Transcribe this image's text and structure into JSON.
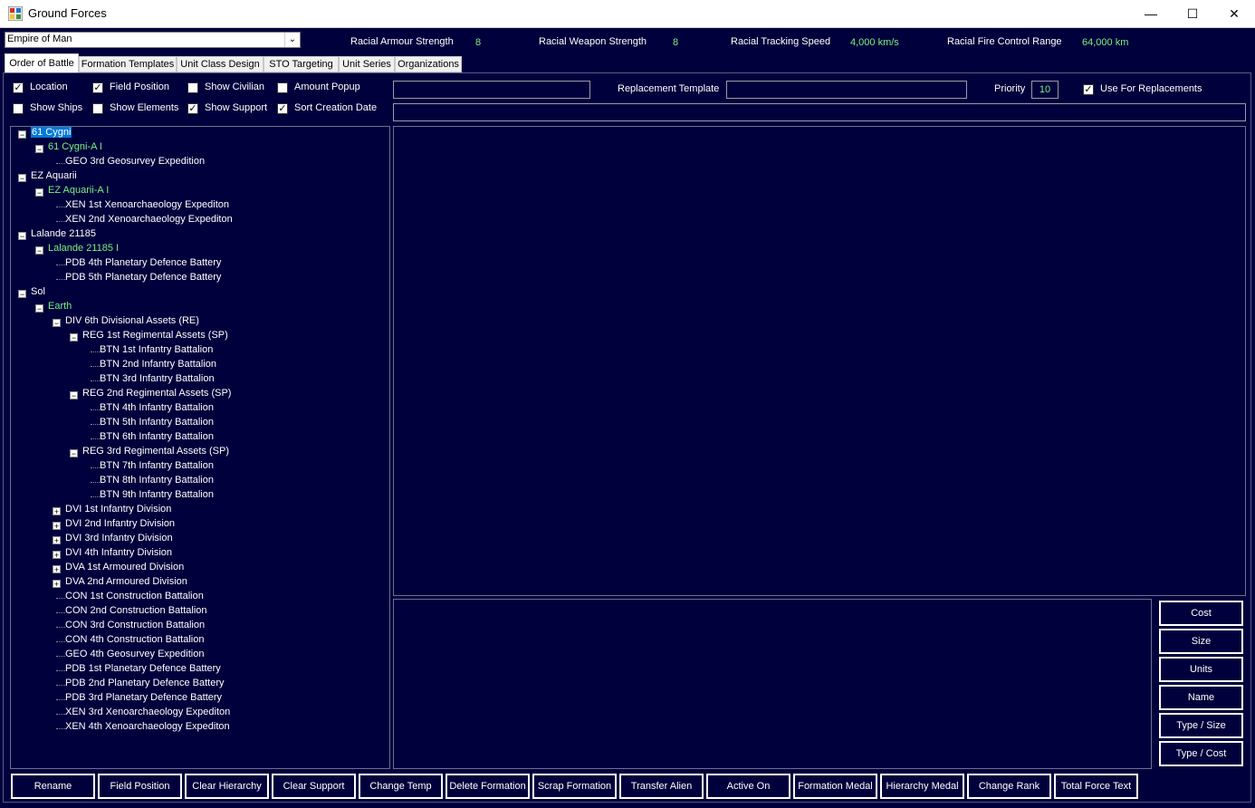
{
  "window": {
    "title": "Ground Forces",
    "minimize": "—",
    "maximize": "☐",
    "close": "✕"
  },
  "race_select": {
    "value": "Empire of Man"
  },
  "stats": [
    {
      "label": "Racial Armour Strength",
      "value": "8"
    },
    {
      "label": "Racial Weapon Strength",
      "value": "8"
    },
    {
      "label": "Racial Tracking Speed",
      "value": "4,000 km/s"
    },
    {
      "label": "Racial Fire Control Range",
      "value": "64,000 km"
    }
  ],
  "tabs": [
    "Order of Battle",
    "Formation Templates",
    "Unit Class Design",
    "STO Targeting",
    "Unit Series",
    "Organizations"
  ],
  "checkboxes": [
    {
      "label": "Location",
      "checked": true
    },
    {
      "label": "Field Position",
      "checked": true
    },
    {
      "label": "Show Civilian",
      "checked": false
    },
    {
      "label": "Amount Popup",
      "checked": false
    },
    {
      "label": "Show Ships",
      "checked": false
    },
    {
      "label": "Show Elements",
      "checked": false
    },
    {
      "label": "Show Support",
      "checked": true
    },
    {
      "label": "Sort Creation Date",
      "checked": true
    }
  ],
  "replacement": {
    "label": "Replacement Template",
    "priority_label": "Priority",
    "priority_value": "10",
    "use_label": "Use For Replacements",
    "use_checked": true
  },
  "tree": [
    {
      "text": "61 Cygni",
      "level": 0,
      "exp": "minus",
      "selected": true
    },
    {
      "text": "61 Cygni-A I",
      "level": 1,
      "exp": "minus",
      "green": true
    },
    {
      "text": "GEO 3rd Geosurvey Expedition",
      "level": 2
    },
    {
      "text": "EZ Aquarii",
      "level": 0,
      "exp": "minus"
    },
    {
      "text": "EZ Aquarii-A I",
      "level": 1,
      "exp": "minus",
      "green": true
    },
    {
      "text": "XEN 1st Xenoarchaeology Expediton",
      "level": 2
    },
    {
      "text": "XEN 2nd Xenoarchaeology Expediton",
      "level": 2
    },
    {
      "text": "Lalande 21185",
      "level": 0,
      "exp": "minus"
    },
    {
      "text": "Lalande 21185 I",
      "level": 1,
      "exp": "minus",
      "green": true
    },
    {
      "text": "PDB 4th Planetary Defence Battery",
      "level": 2
    },
    {
      "text": "PDB 5th Planetary Defence Battery",
      "level": 2
    },
    {
      "text": "Sol",
      "level": 0,
      "exp": "minus"
    },
    {
      "text": "Earth",
      "level": 1,
      "exp": "minus",
      "green": true
    },
    {
      "text": "DIV 6th Divisional Assets  (RE)",
      "level": 2,
      "exp": "minus"
    },
    {
      "text": "REG 1st Regimental Assets  (SP)",
      "level": 3,
      "exp": "minus"
    },
    {
      "text": "BTN 1st Infantry Battalion",
      "level": 4
    },
    {
      "text": "BTN 2nd Infantry Battalion",
      "level": 4
    },
    {
      "text": "BTN 3rd Infantry Battalion",
      "level": 4
    },
    {
      "text": "REG 2nd Regimental Assets  (SP)",
      "level": 3,
      "exp": "minus"
    },
    {
      "text": "BTN 4th Infantry Battalion",
      "level": 4
    },
    {
      "text": "BTN 5th Infantry Battalion",
      "level": 4
    },
    {
      "text": "BTN 6th Infantry Battalion",
      "level": 4
    },
    {
      "text": "REG 3rd Regimental Assets  (SP)",
      "level": 3,
      "exp": "minus"
    },
    {
      "text": "BTN 7th Infantry Battalion",
      "level": 4
    },
    {
      "text": "BTN 8th Infantry Battalion",
      "level": 4
    },
    {
      "text": "BTN 9th Infantry Battalion",
      "level": 4
    },
    {
      "text": "DVI 1st Infantry Division",
      "level": 2,
      "exp": "plus"
    },
    {
      "text": "DVI 2nd Infantry Division",
      "level": 2,
      "exp": "plus"
    },
    {
      "text": "DVI 3rd Infantry Division",
      "level": 2,
      "exp": "plus"
    },
    {
      "text": "DVI 4th Infantry Division",
      "level": 2,
      "exp": "plus"
    },
    {
      "text": "DVA 1st Armoured Division",
      "level": 2,
      "exp": "plus"
    },
    {
      "text": "DVA 2nd Armoured Division",
      "level": 2,
      "exp": "plus"
    },
    {
      "text": "CON 1st Construction Battalion",
      "level": 2
    },
    {
      "text": "CON 2nd Construction Battalion",
      "level": 2
    },
    {
      "text": "CON 3rd Construction Battalion",
      "level": 2
    },
    {
      "text": "CON 4th Construction Battalion",
      "level": 2
    },
    {
      "text": "GEO 4th Geosurvey Expedition",
      "level": 2
    },
    {
      "text": "PDB 1st Planetary Defence Battery",
      "level": 2
    },
    {
      "text": "PDB 2nd Planetary Defence Battery",
      "level": 2
    },
    {
      "text": "PDB 3rd Planetary Defence Battery",
      "level": 2
    },
    {
      "text": "XEN 3rd Xenoarchaeology Expediton",
      "level": 2
    },
    {
      "text": "XEN 4th Xenoarchaeology Expediton",
      "level": 2
    }
  ],
  "sort_buttons": [
    "Cost",
    "Size",
    "Units",
    "Name",
    "Type / Size",
    "Type / Cost"
  ],
  "bottom_buttons": [
    "Rename",
    "Field Position",
    "Clear Hierarchy",
    "Clear Support",
    "Change Temp",
    "Delete Formation",
    "Scrap Formation",
    "Transfer Alien",
    "Active On",
    "Formation Medal",
    "Hierarchy Medal",
    "Change Rank",
    "Total Force Text"
  ],
  "colors": {
    "background": "#00003c",
    "green_text": "#7df07d",
    "selection": "#0078d7"
  }
}
